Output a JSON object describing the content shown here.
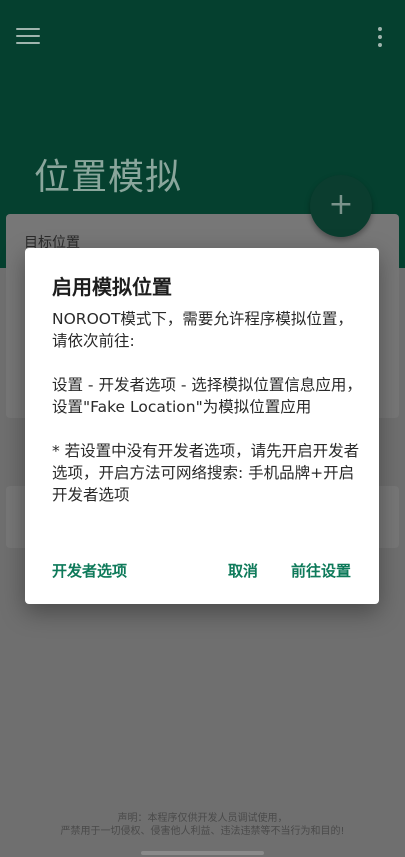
{
  "appbar": {
    "menu_icon": "menu-icon",
    "more_icon": "more-vert-icon",
    "title": "位置模拟"
  },
  "card": {
    "title": "目标位置"
  },
  "fab": {
    "label": "+"
  },
  "dialog": {
    "title": "启用模拟位置",
    "body": "NOROOT模式下，需要允许程序模拟位置，\n请依次前往:\n\n设置 - 开发者选项 - 选择模拟位置信息应用，设置\"Fake Location\"为模拟位置应用\n\n* 若设置中没有开发者选项，请先开启开发者选项，开启方法可网络搜索: 手机品牌+开启开发者选项",
    "actions": {
      "developer_options": "开发者选项",
      "cancel": "取消",
      "go_settings": "前往设置"
    }
  },
  "footer": {
    "line1": "声明：本程序仅供开发人员调试使用，",
    "line2": "严禁用于一切侵权、侵害他人利益、违法违禁等不当行为和目的!"
  },
  "colors": {
    "appbar": "#05402f",
    "accent": "#0e7a5a",
    "dialog_bg": "#ffffff"
  }
}
